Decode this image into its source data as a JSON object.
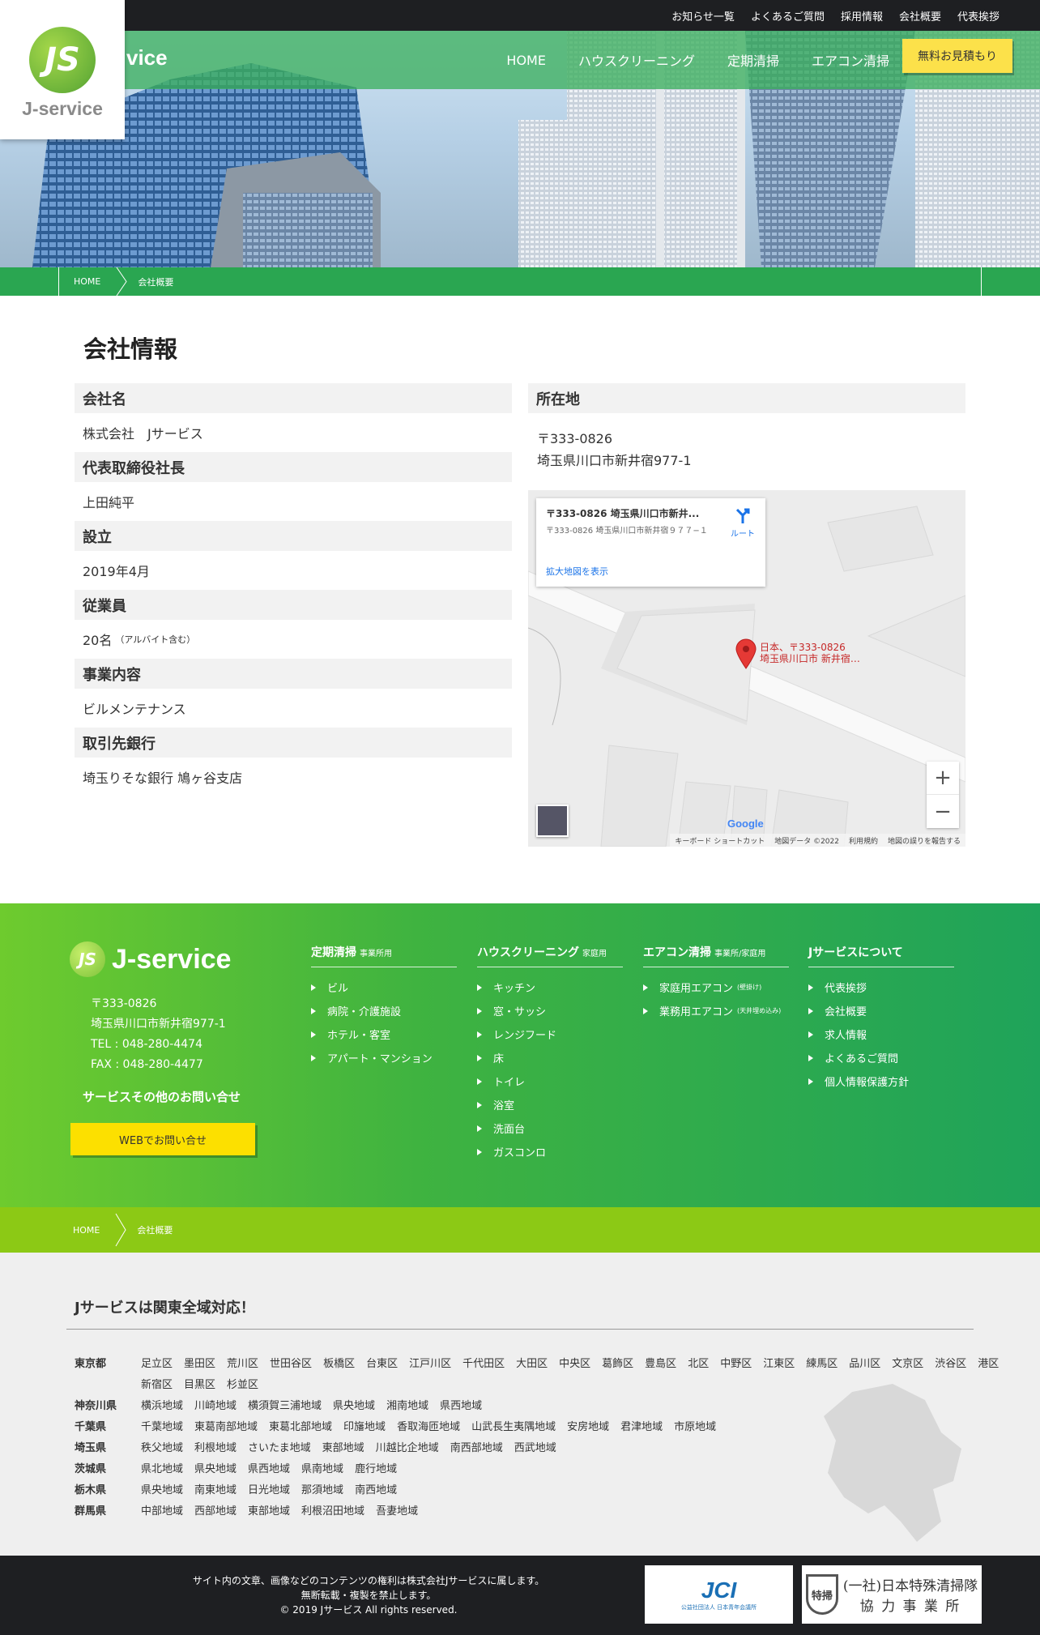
{
  "top_links": [
    "お知らせ一覧",
    "よくあるご質問",
    "採用情報",
    "会社概要",
    "代表挨拶"
  ],
  "logo": {
    "mark": "JS",
    "text": "J-service",
    "hero_text": "vice"
  },
  "nav": [
    "HOME",
    "ハウスクリーニング",
    "定期清掃",
    "エアコン清掃"
  ],
  "estimate_button": "無料お見積もり",
  "breadcrumb": {
    "home": "HOME",
    "current": "会社概要"
  },
  "page_title": "会社情報",
  "company": [
    {
      "label": "会社名",
      "value": "株式会社　Jサービス",
      "note": ""
    },
    {
      "label": "代表取締役社長",
      "value": "上田純平",
      "note": ""
    },
    {
      "label": "設立",
      "value": "2019年4月",
      "note": ""
    },
    {
      "label": "従業員",
      "value": "20名",
      "note": "（アルバイト含む）"
    },
    {
      "label": "事業内容",
      "value": "ビルメンテナンス",
      "note": ""
    },
    {
      "label": "取引先銀行",
      "value": "埼玉りそな銀行 鳩ヶ谷支店",
      "note": ""
    }
  ],
  "location": {
    "label": "所在地",
    "zip": "〒333-0826",
    "address": "埼玉県川口市新井宿977-1"
  },
  "map": {
    "place_title": "〒333-0826 埼玉県川口市新井...",
    "place_address": "〒333-0826 埼玉県川口市新井宿９７７−１",
    "route": "ルート",
    "larger_map": "拡大地図を表示",
    "pin_label_1": "日本、〒333-0826",
    "pin_label_2": "埼玉県川口市 新井宿…",
    "zoom_in": "+",
    "zoom_out": "−",
    "google": "Google",
    "attrib": [
      "キーボード ショートカット",
      "地図データ ©2022",
      "利用規約",
      "地図の誤りを報告する"
    ]
  },
  "footer": {
    "logo": "J-service",
    "zip": "〒333-0826",
    "address": "埼玉県川口市新井宿977-1",
    "tel": "TEL : 048-280-4474",
    "fax": "FAX : 048-280-4477",
    "inquiry_title": "サービスその他のお問い合せ",
    "web_button": "WEBでお問い合せ",
    "columns": [
      {
        "title": "定期清掃",
        "sub": "事業所用",
        "items": [
          {
            "t": "ビル",
            "s": ""
          },
          {
            "t": "病院・介護施設",
            "s": ""
          },
          {
            "t": "ホテル・客室",
            "s": ""
          },
          {
            "t": "アパート・マンション",
            "s": ""
          }
        ]
      },
      {
        "title": "ハウスクリーニング",
        "sub": "家庭用",
        "items": [
          {
            "t": "キッチン",
            "s": ""
          },
          {
            "t": "窓・サッシ",
            "s": ""
          },
          {
            "t": "レンジフード",
            "s": ""
          },
          {
            "t": "床",
            "s": ""
          },
          {
            "t": "トイレ",
            "s": ""
          },
          {
            "t": "浴室",
            "s": ""
          },
          {
            "t": "洗面台",
            "s": ""
          },
          {
            "t": "ガスコンロ",
            "s": ""
          }
        ]
      },
      {
        "title": "エアコン清掃",
        "sub": "事業所/家庭用",
        "items": [
          {
            "t": "家庭用エアコン",
            "s": "(壁掛け)"
          },
          {
            "t": "業務用エアコン",
            "s": "(天井埋め込み)"
          }
        ]
      },
      {
        "title": "Jサービスについて",
        "sub": "",
        "items": [
          {
            "t": "代表挨拶",
            "s": ""
          },
          {
            "t": "会社概要",
            "s": ""
          },
          {
            "t": "求人情報",
            "s": ""
          },
          {
            "t": "よくあるご質問",
            "s": ""
          },
          {
            "t": "個人情報保護方針",
            "s": ""
          }
        ]
      }
    ]
  },
  "areas": {
    "title": "Jサービスは関東全域対応！",
    "rows": [
      {
        "pref": "東京都",
        "cities": [
          "足立区",
          "墨田区",
          "荒川区",
          "世田谷区",
          "板橋区",
          "台東区",
          "江戸川区",
          "千代田区",
          "大田区",
          "中央区",
          "葛飾区",
          "豊島区",
          "北区",
          "中野区",
          "江東区",
          "練馬区",
          "品川区",
          "文京区",
          "渋谷区",
          "港区",
          "新宿区",
          "目黒区",
          "杉並区"
        ]
      },
      {
        "pref": "神奈川県",
        "cities": [
          "横浜地域",
          "川崎地域",
          "横須賀三浦地域",
          "県央地域",
          "湘南地域",
          "県西地域"
        ]
      },
      {
        "pref": "千葉県",
        "cities": [
          "千葉地域",
          "東葛南部地域",
          "東葛北部地域",
          "印旛地域",
          "香取海匝地域",
          "山武長生夷隅地域",
          "安房地域",
          "君津地域",
          "市原地域"
        ]
      },
      {
        "pref": "埼玉県",
        "cities": [
          "秩父地域",
          "利根地域",
          "さいたま地域",
          "東部地域",
          "川越比企地域",
          "南西部地域",
          "西武地域"
        ]
      },
      {
        "pref": "茨城県",
        "cities": [
          "県北地域",
          "県央地域",
          "県西地域",
          "県南地域",
          "鹿行地域"
        ]
      },
      {
        "pref": "栃木県",
        "cities": [
          "県央地域",
          "南東地域",
          "日光地域",
          "那須地域",
          "南西地域"
        ]
      },
      {
        "pref": "群馬県",
        "cities": [
          "中部地域",
          "西部地域",
          "東部地域",
          "利根沼田地域",
          "吾妻地域"
        ]
      }
    ]
  },
  "copyright": {
    "line1": "サイト内の文章、画像などのコンテンツの権利は株式会社Jサービスに属します。",
    "line2": "無断転載・複製を禁止します。",
    "line3": "© 2019 Jサービス All rights reserved."
  },
  "partners": {
    "jci": "JCI",
    "jci_sub": "公益社団法人 日本青年会議所",
    "toku_mark": "特掃",
    "toku_text_1": "(一社)日本特殊清掃隊",
    "toku_text_2": "協 力 事 業 所"
  },
  "colors": {
    "green": "#2aa651",
    "yellow": "#fce14a",
    "lime": "#8cc915",
    "dark": "#1e1f22"
  }
}
